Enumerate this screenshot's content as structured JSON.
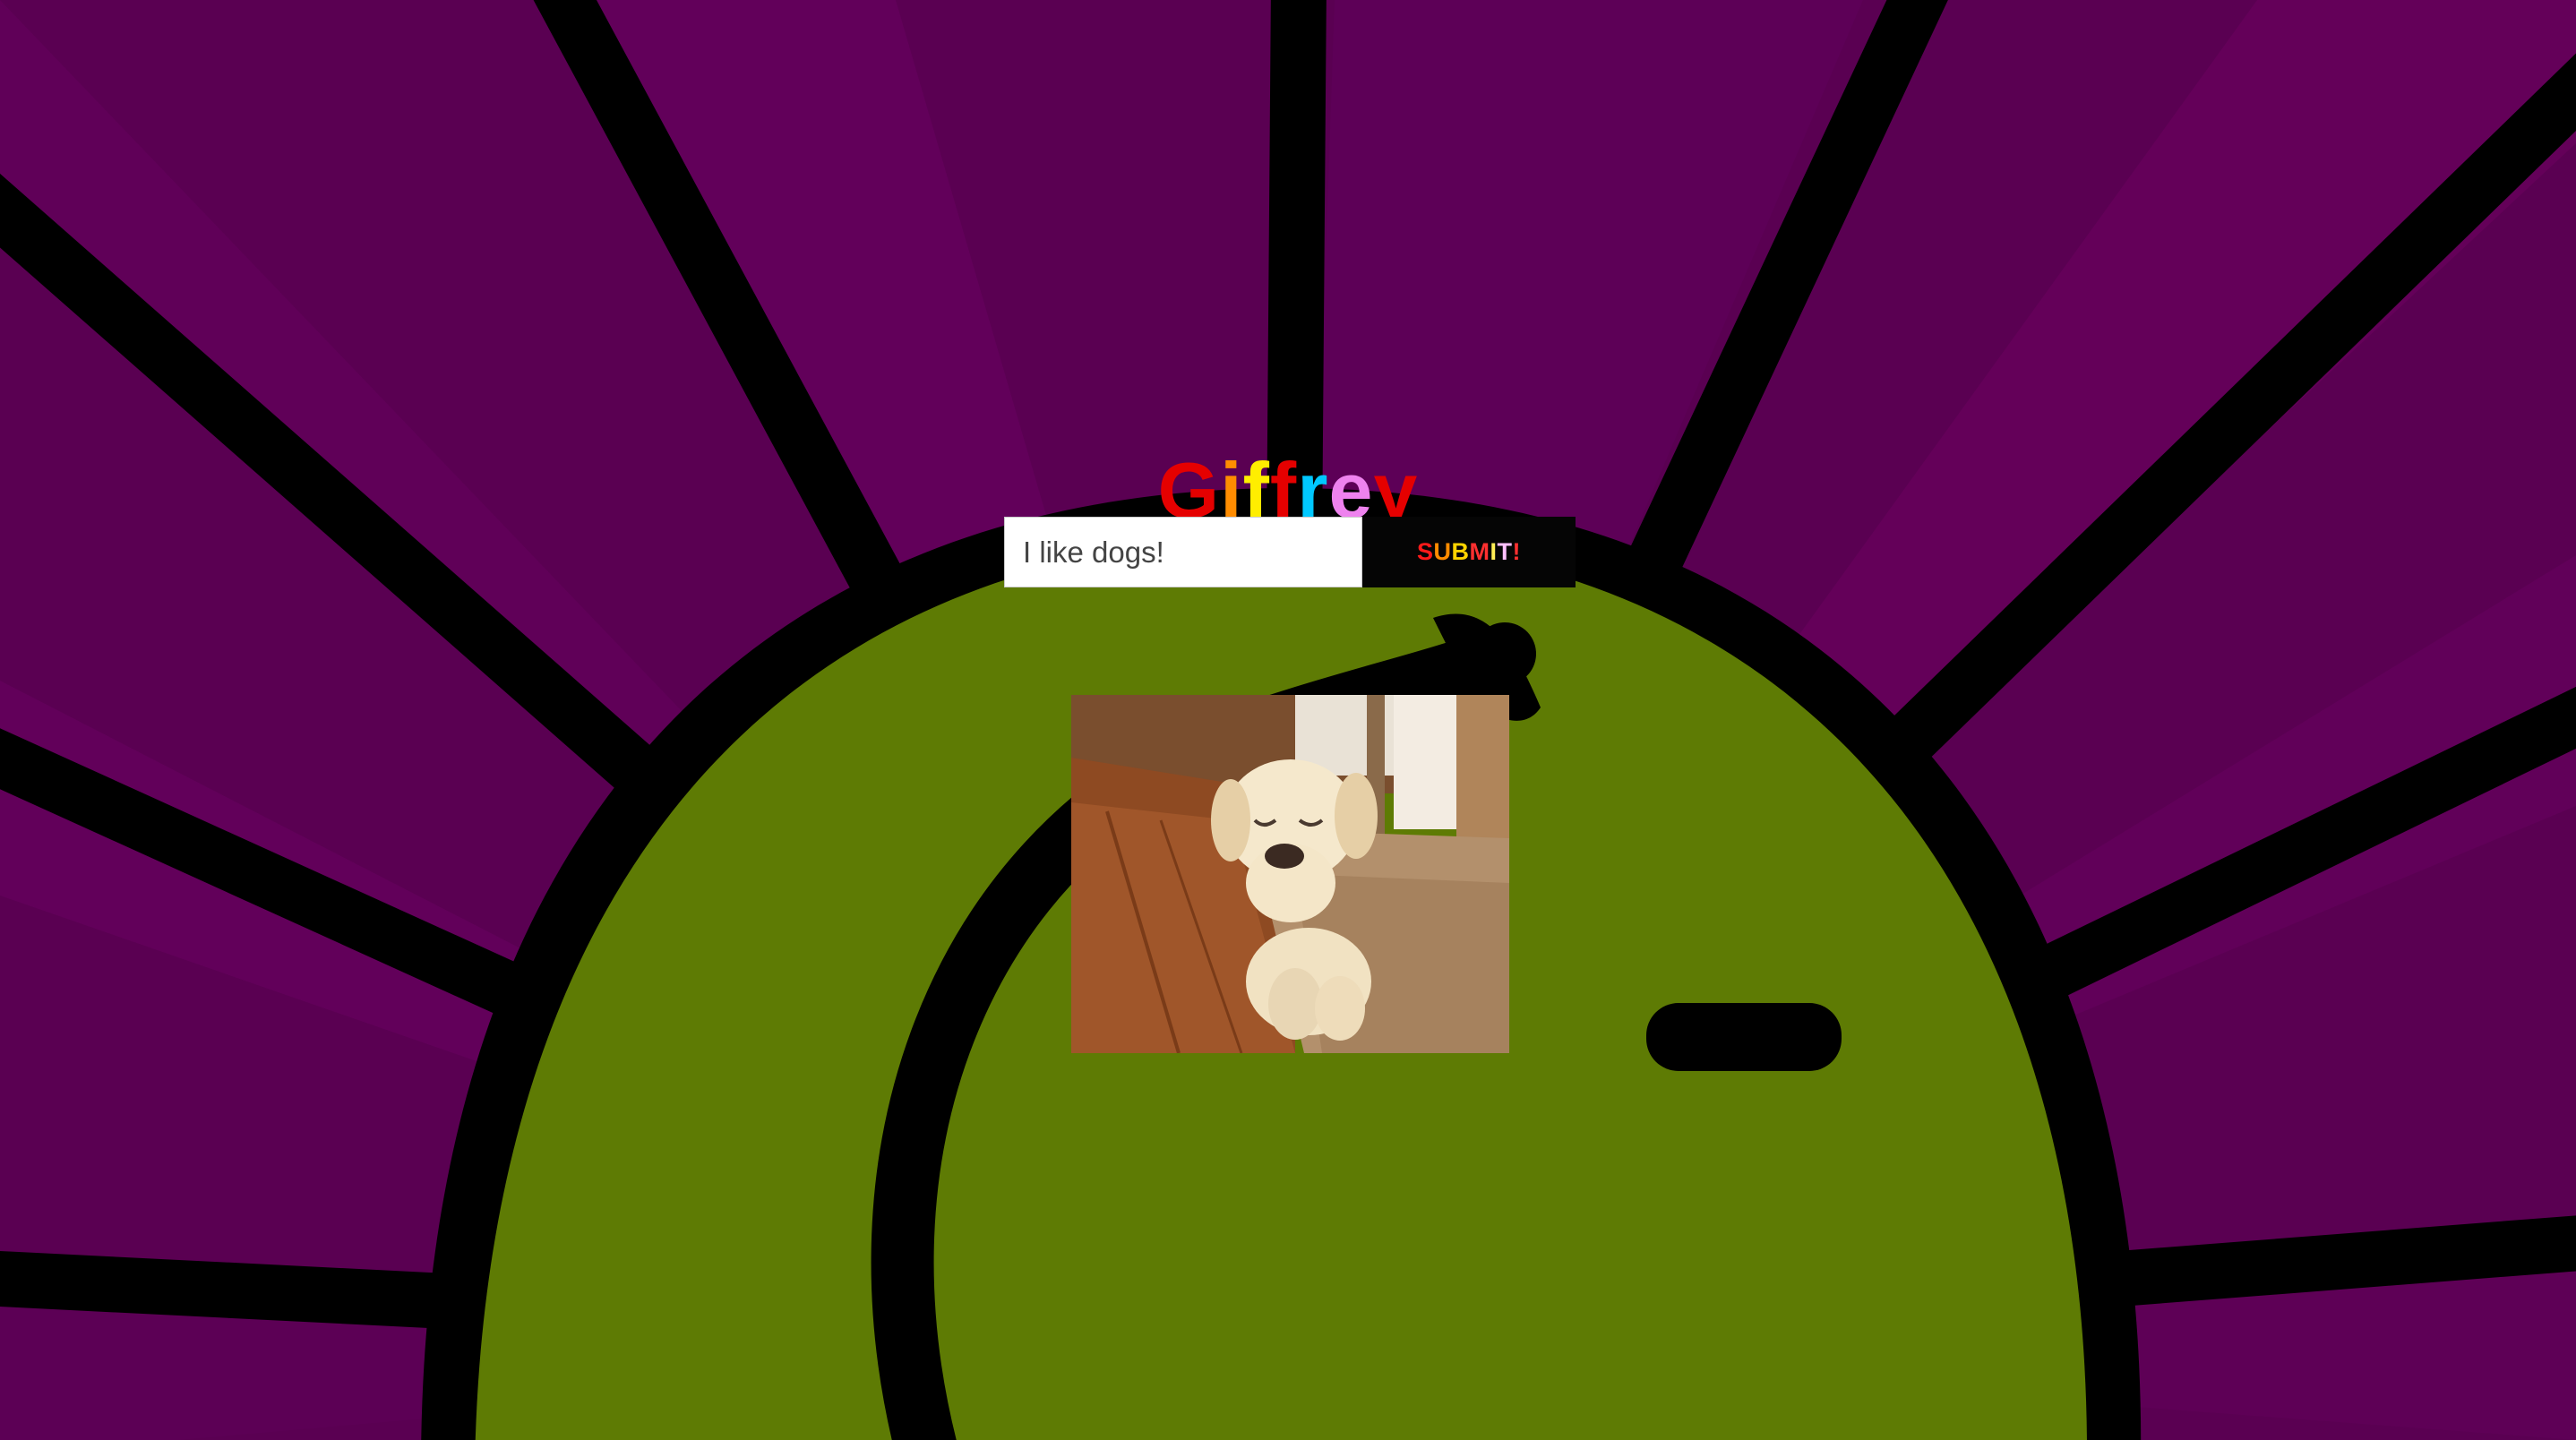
{
  "app": {
    "title_letters": [
      "G",
      "i",
      "f",
      "f",
      "r",
      "e",
      "y"
    ],
    "title_colors": [
      "#e50000",
      "#ff8c00",
      "#ffee00",
      "#e50000",
      "#00c8ff",
      "#ee82ee",
      "#e50000"
    ]
  },
  "search": {
    "value": "I like dogs!",
    "placeholder": ""
  },
  "submit": {
    "letters": [
      "S",
      "U",
      "B",
      "M",
      "I",
      "T",
      "!"
    ],
    "letter_colors": [
      "#ff1a1a",
      "#ff8c00",
      "#ffd400",
      "#ff3030",
      "#ffee55",
      "#ffc0ff",
      "#ff3030"
    ]
  },
  "result": {
    "image_icon": "puppy-gif-image"
  },
  "colors": {
    "background_purple": "#5e0057",
    "background_green": "#5e7b04",
    "outline": "#000000"
  }
}
